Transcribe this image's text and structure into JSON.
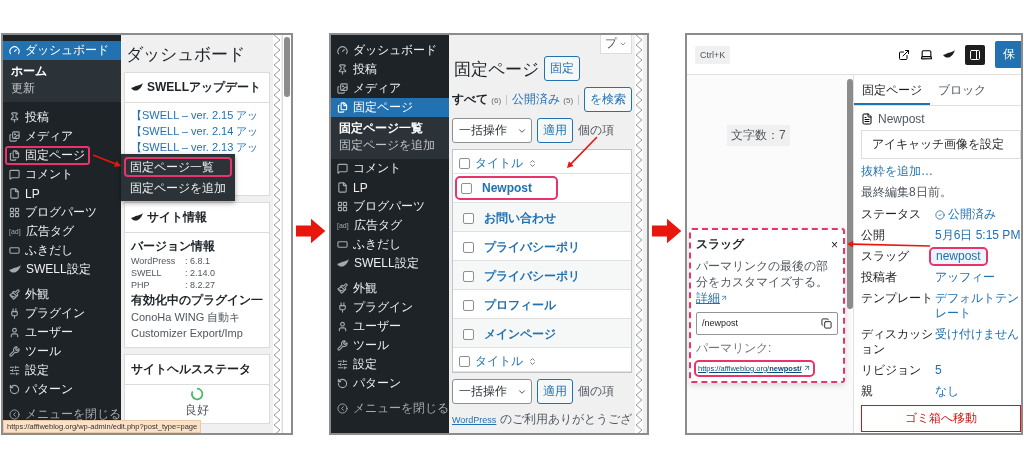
{
  "dashboard_screen": {
    "sidebar": {
      "groups": [
        {
          "items": [
            {
              "label": "ダッシュボード",
              "selected": true,
              "highlighted": false,
              "children": [
                {
                  "label": "ホーム",
                  "selected": true
                },
                {
                  "label": "更新",
                  "selected": false
                }
              ]
            }
          ]
        },
        {
          "items": [
            {
              "label": "投稿",
              "selected": false,
              "highlighted": false
            },
            {
              "label": "メディア",
              "selected": false,
              "highlighted": false
            },
            {
              "label": "固定ページ",
              "selected": false,
              "highlighted": true,
              "flyout": [
                {
                  "label": "固定ページ一覧",
                  "highlighted": true
                },
                {
                  "label": "固定ページを追加",
                  "highlighted": false
                }
              ]
            },
            {
              "label": "コメント",
              "selected": false,
              "highlighted": false
            },
            {
              "label": "LP",
              "selected": false,
              "highlighted": false
            },
            {
              "label": "ブログパーツ",
              "selected": false,
              "highlighted": false
            },
            {
              "label": "広告タグ",
              "icon_text": "[ad]",
              "selected": false,
              "highlighted": false
            },
            {
              "label": "ふきだし",
              "selected": false,
              "highlighted": false
            },
            {
              "label": "SWELL設定",
              "selected": false,
              "highlighted": false
            }
          ]
        },
        {
          "items": [
            {
              "label": "外観",
              "selected": false,
              "highlighted": false
            },
            {
              "label": "プラグイン",
              "selected": false,
              "highlighted": false
            },
            {
              "label": "ユーザー",
              "selected": false,
              "highlighted": false
            },
            {
              "label": "ツール",
              "selected": false,
              "highlighted": false
            },
            {
              "label": "設定",
              "selected": false,
              "highlighted": false
            },
            {
              "label": "パターン",
              "selected": false,
              "highlighted": false
            }
          ]
        }
      ],
      "collapse_label": "メニューを閉じる"
    },
    "heading": "ダッシュボード",
    "cards": [
      {
        "kind": "links",
        "title": "SWELLアップデート",
        "links": [
          "【SWELL – ver. 2.15 アッ",
          "【SWELL – ver. 2.14 アッ",
          "【SWELL – ver. 2.13 アッ"
        ]
      },
      {
        "kind": "info",
        "title": "サイト情報",
        "subtitle": "バージョン情報",
        "versions": [
          {
            "name": "WordPress",
            "value": ": 6.8.1"
          },
          {
            "name": "SWELL",
            "value": ": 2.14.0"
          },
          {
            "name": "PHP",
            "value": ": 8.2.27"
          }
        ],
        "plugins_title": "有効化中のプラグイン一",
        "plugins": [
          "ConoHa WING 自動キ",
          "Customizer Export/Imp"
        ]
      },
      {
        "kind": "health",
        "title": "サイトヘルスステータ",
        "status": "良好"
      }
    ],
    "status_url": "https://affiweblog.org/wp-admin/edit.php?post_type=page"
  },
  "pages_screen": {
    "sidebar": {
      "groups": [
        {
          "items": [
            {
              "label": "ダッシュボード",
              "selected": false
            },
            {
              "label": "投稿",
              "selected": false
            },
            {
              "label": "メディア",
              "selected": false
            },
            {
              "label": "固定ページ",
              "selected": true,
              "children": [
                {
                  "label": "固定ページ一覧",
                  "selected": true
                },
                {
                  "label": "固定ページを追加",
                  "selected": false
                }
              ]
            },
            {
              "label": "コメント",
              "selected": false
            },
            {
              "label": "LP",
              "selected": false
            },
            {
              "label": "ブログパーツ",
              "selected": false
            },
            {
              "label": "広告タグ",
              "icon_text": "[ad]",
              "selected": false
            },
            {
              "label": "ふきだし",
              "selected": false
            },
            {
              "label": "SWELL設定",
              "selected": false
            }
          ]
        },
        {
          "items": [
            {
              "label": "外観",
              "selected": false
            },
            {
              "label": "プラグイン",
              "selected": false
            },
            {
              "label": "ユーザー",
              "selected": false
            },
            {
              "label": "ツール",
              "selected": false
            },
            {
              "label": "設定",
              "selected": false
            },
            {
              "label": "パターン",
              "selected": false
            }
          ]
        }
      ],
      "collapse_label": "メニューを閉じる"
    },
    "help_tab": "プ",
    "heading": "固定ページ",
    "add_button": "固定",
    "filters": [
      {
        "label": "すべて",
        "count": "(6)",
        "selected": true
      },
      {
        "label": "公開済み",
        "count": "(5)",
        "selected": false
      }
    ],
    "search_button": "を検索",
    "bulk_actions": [
      {
        "select": "一括操作",
        "apply": "適用",
        "count": "個の項"
      },
      {
        "select": "一括操作",
        "apply": "適用",
        "count": "個の項"
      }
    ],
    "title_columns": [
      {
        "label": "タイトル",
        "checked": false
      },
      {
        "label": "タイトル",
        "checked": false
      }
    ],
    "rows": [
      {
        "title": "Newpost",
        "checked": false,
        "highlighted": true
      },
      {
        "title": "お問い合わせ",
        "checked": false,
        "highlighted": false
      },
      {
        "title": "プライバシーポリ",
        "checked": false,
        "highlighted": false
      },
      {
        "title": "プライバシーポリ",
        "checked": false,
        "highlighted": false
      },
      {
        "title": "プロフィール",
        "checked": false,
        "highlighted": false
      },
      {
        "title": "メインページ",
        "checked": false,
        "highlighted": false
      }
    ],
    "footer_link": "WordPress",
    "footer_text": "のご利用ありがとうござ"
  },
  "editor_screen": {
    "shortcut": "Ctrl+K",
    "save_button": "保",
    "word_count": "文字数：7",
    "popover": {
      "title": "スラッグ",
      "close": "×",
      "description": "パーマリンクの最後の部分をカスタマイズする。",
      "help_link": "詳細",
      "slug_value": "/newpost",
      "permalink_label": "パーマリンク:",
      "permalink_url": "https://affiweblog.org/**newpost/**",
      "permalink_highlighted": true
    },
    "tabs": [
      {
        "label": "固定ページ",
        "selected": true
      },
      {
        "label": "ブロック",
        "selected": false
      }
    ],
    "page_title": "Newpost",
    "featured_image_button": "アイキャッチ画像を設定",
    "excerpt_link": "抜粋を追加…",
    "last_edited": "最終編集8日前。",
    "rows": [
      {
        "kind": "status",
        "label": "ステータス",
        "value": "公開済み",
        "highlighted": false
      },
      {
        "kind": "text",
        "label": "公開",
        "value": "5月6日 5:15 PM",
        "highlighted": false
      },
      {
        "kind": "text",
        "label": "スラッグ",
        "value": "newpost",
        "highlighted": true
      },
      {
        "kind": "text",
        "label": "投稿者",
        "value": "アッフィー",
        "highlighted": false
      },
      {
        "kind": "lines",
        "label": "テンプレート",
        "value_lines": [
          "デフォルトテン",
          "レート"
        ],
        "highlighted": false
      },
      {
        "kind": "text",
        "label": "ディスカッション",
        "value": "受け付けません",
        "highlighted": false
      },
      {
        "kind": "text",
        "label": "リビジョン",
        "value": "5",
        "highlighted": false
      },
      {
        "kind": "text",
        "label": "親",
        "value": "なし",
        "highlighted": false
      }
    ],
    "trash_button": "ゴミ箱へ移動"
  }
}
